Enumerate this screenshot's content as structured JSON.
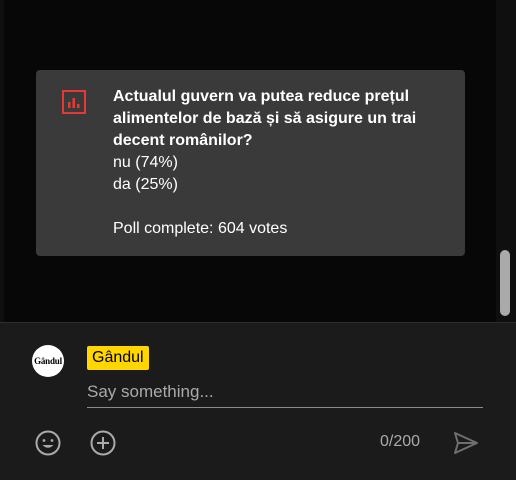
{
  "poll": {
    "question": "Actualul guvern va putea reduce prețul alimentelor de bază și să asigure un trai decent românilor?",
    "options": [
      "nu (74%)",
      "da (25%)"
    ],
    "status": "Poll complete: 604 votes",
    "icon": "poll-chart-icon",
    "icon_color": "#e53935"
  },
  "composer": {
    "avatar_text": "Gândul",
    "author_name": "Gândul",
    "author_badge_color": "#ffd600",
    "placeholder": "Say something...",
    "char_count": "0/200",
    "icons": [
      "emoji-icon",
      "add-icon",
      "send-icon"
    ]
  }
}
